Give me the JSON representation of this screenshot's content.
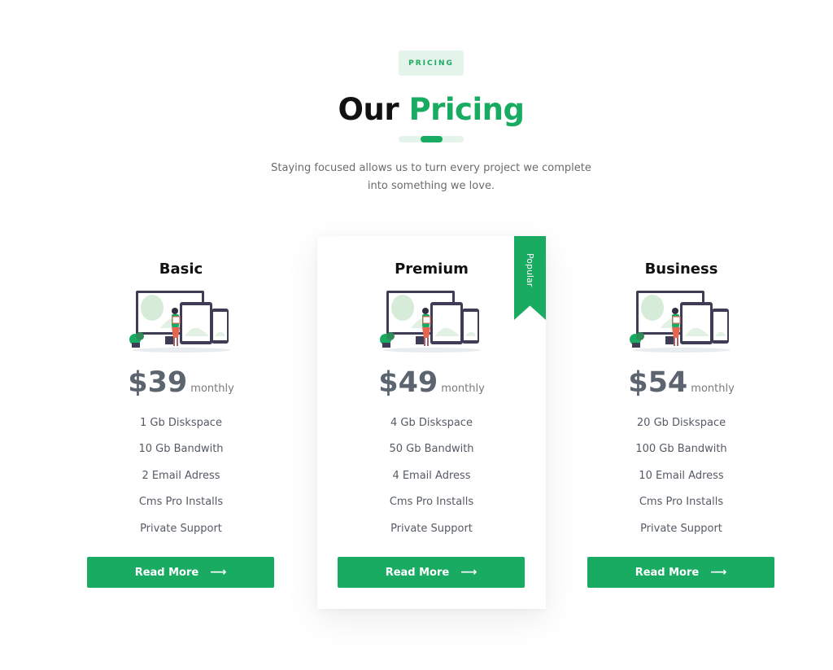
{
  "header": {
    "badge": "PRICING",
    "title_part1": "Our",
    "title_part2": "Pricing",
    "subtitle": "Staying focused allows us to turn every project we complete into something we love."
  },
  "colors": {
    "accent": "#1aab62",
    "accent_light": "#e4f4eb",
    "price": "#5c6470",
    "heading": "#111111"
  },
  "plans": [
    {
      "name": "Basic",
      "price": "$39",
      "period": "monthly",
      "features": [
        "1 Gb Diskspace",
        "10 Gb Bandwith",
        "2 Email Adress",
        "Cms Pro Installs",
        "Private Support"
      ],
      "button": "Read More",
      "button_icon": "arrow-right-icon"
    },
    {
      "name": "Premium",
      "price": "$49",
      "period": "monthly",
      "ribbon": "Popular",
      "features": [
        "4 Gb Diskspace",
        "50 Gb Bandwith",
        "4 Email Adress",
        "Cms Pro Installs",
        "Private Support"
      ],
      "button": "Read More",
      "button_icon": "arrow-right-icon"
    },
    {
      "name": "Business",
      "price": "$54",
      "period": "monthly",
      "features": [
        "20 Gb Diskspace",
        "100 Gb Bandwith",
        "10 Email Adress",
        "Cms Pro Installs",
        "Private Support"
      ],
      "button": "Read More",
      "button_icon": "arrow-right-icon"
    }
  ]
}
